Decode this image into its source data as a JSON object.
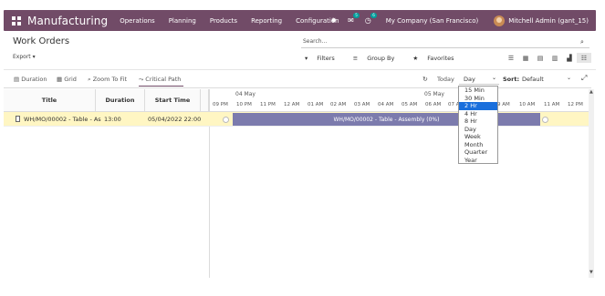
{
  "navbar": {
    "app_name": "Manufacturing",
    "menu": [
      "Operations",
      "Planning",
      "Products",
      "Reporting",
      "Configuration"
    ],
    "chat_badge": "5",
    "activity_badge": "6",
    "company": "My Company (San Francisco)",
    "user": "Mitchell Admin (gant_15)",
    "bg_color": "#714b67"
  },
  "control": {
    "breadcrumb": "Work Orders",
    "export_label": "Export",
    "search_placeholder": "Search...",
    "filters_label": "Filters",
    "group_by_label": "Group By",
    "favorites_label": "Favorites"
  },
  "gantt_toolbar": {
    "duration_label": "Duration",
    "grid_label": "Grid",
    "zoom_label": "Zoom To Fit",
    "critical_label": "Critical Path",
    "today_label": "Today",
    "scale_value": "Day",
    "sort_label": "Sort:",
    "sort_value": "Default"
  },
  "table": {
    "headers": {
      "title": "Title",
      "duration": "Duration",
      "start": "Start Time"
    },
    "dates": [
      "04 May",
      "05 May"
    ],
    "hours": [
      "09 PM",
      "10 PM",
      "11 PM",
      "12 AM",
      "01 AM",
      "02 AM",
      "03 AM",
      "04 AM",
      "05 AM",
      "06 AM",
      "07 A",
      "9 AM",
      "10 AM",
      "11 AM",
      "12 PM"
    ],
    "rows": [
      {
        "title": "WH/MO/00002 - Table - Assembly",
        "duration": "13:00",
        "start": "05/04/2022 22:00:00",
        "bar_label": "WH/MO/00002 - Table - Assembly (0%)"
      }
    ]
  },
  "scale_dropdown": {
    "options": [
      "15 Min",
      "30 Min",
      "2 Hr",
      "4 Hr",
      "8 Hr",
      "Day",
      "Week",
      "Month",
      "Quarter",
      "Year"
    ],
    "selected": "2 Hr",
    "selected_color": "#1a6fdc"
  },
  "colors": {
    "bar": "#7c7bad",
    "row_highlight": "#fff6c3"
  }
}
